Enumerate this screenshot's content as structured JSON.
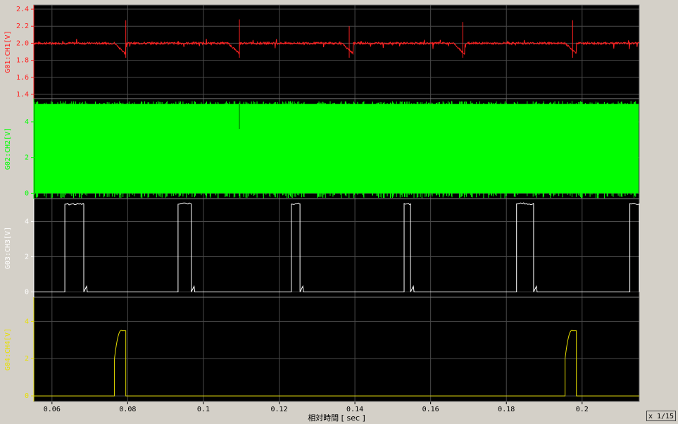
{
  "chart_data": {
    "type": "line",
    "x_axis": {
      "label": "相対時間 [ sec ]",
      "range": [
        0.0552,
        0.2151
      ],
      "ticks": [
        0.06,
        0.08,
        0.1,
        0.12,
        0.14,
        0.16,
        0.18,
        0.2
      ],
      "tick_labels": [
        "0.06",
        "0.08",
        "0.1",
        "0.12",
        "0.14",
        "0.16",
        "0.18",
        "0.2"
      ]
    },
    "grid": true,
    "zoom_label": "x 1/15",
    "series": [
      {
        "name": "G01:CH1[V]",
        "color": "#ff2020",
        "ylim": [
          1.35,
          2.45
        ],
        "ticks": [
          1.4,
          1.6,
          1.8,
          2.0,
          2.2,
          2.4
        ],
        "tick_labels": [
          "1.4",
          "1.6",
          "1.8",
          "2.0",
          "2.2",
          "2.4"
        ],
        "baseline": 2.0,
        "dips": [
          {
            "start": 0.0765,
            "end": 0.0795,
            "min": 1.87,
            "spike_at": 0.0795,
            "spike_max": 2.27
          },
          {
            "start": 0.1065,
            "end": 0.1095,
            "min": 1.88,
            "spike_at": 0.1095,
            "spike_max": 2.28
          },
          {
            "start": 0.1365,
            "end": 0.1395,
            "min": 1.88,
            "spike_at": 0.1385,
            "spike_max": 2.2
          },
          {
            "start": 0.166,
            "end": 0.169,
            "min": 1.87,
            "spike_at": 0.1685,
            "spike_max": 2.25
          },
          {
            "start": 0.1955,
            "end": 0.1985,
            "min": 1.88,
            "spike_at": 0.1975,
            "spike_max": 2.27
          }
        ]
      },
      {
        "name": "G02:CH2[V]",
        "color": "#00ff00",
        "ylim": [
          -0.3,
          5.3
        ],
        "ticks": [
          0,
          2,
          4
        ],
        "tick_labels": [
          "0",
          "2",
          "4"
        ],
        "band_low": 0.0,
        "band_high": 5.0,
        "glitches": [
          {
            "x": 0.1095,
            "min": 3.6
          }
        ]
      },
      {
        "name": "G03:CH3[V]",
        "color": "#ffffff",
        "ylim": [
          -0.3,
          5.3
        ],
        "ticks": [
          0,
          2,
          4
        ],
        "tick_labels": [
          "0",
          "2",
          "4"
        ],
        "low": 0.0,
        "high": 5.0,
        "pulses": [
          [
            0.0634,
            0.0684
          ],
          [
            0.0933,
            0.0968
          ],
          [
            0.1232,
            0.1255
          ],
          [
            0.153,
            0.1547
          ],
          [
            0.1827,
            0.1872
          ],
          [
            0.2126,
            0.2151
          ]
        ]
      },
      {
        "name": "G04:CH4[V]",
        "color": "#e8e000",
        "ylim": [
          -0.3,
          5.3
        ],
        "ticks": [
          0,
          2,
          4
        ],
        "tick_labels": [
          "0",
          "2",
          "4"
        ],
        "low": 0.0,
        "pulses": [
          {
            "rise": 0.0765,
            "top": 3.5,
            "ramp_start": 2.0,
            "ramp_end": 0.0785,
            "fall": 0.0795
          },
          {
            "rise": 0.1955,
            "top": 3.5,
            "ramp_start": 2.0,
            "ramp_end": 0.1975,
            "fall": 0.1985
          }
        ]
      }
    ]
  }
}
